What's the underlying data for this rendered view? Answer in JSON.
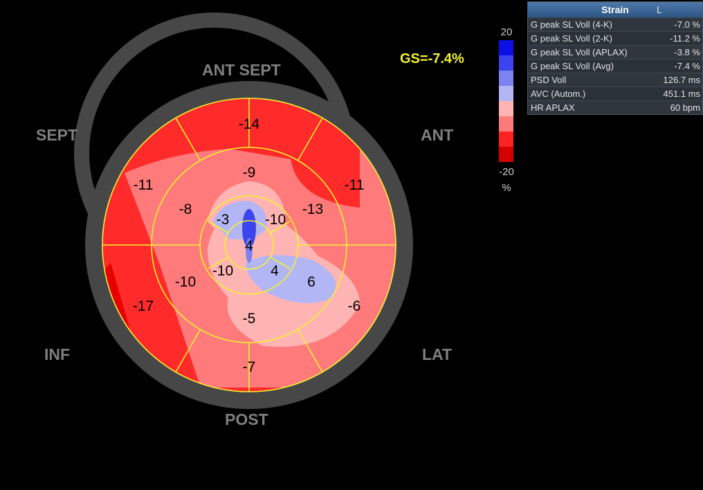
{
  "wall_labels": {
    "ant_sept": "ANT  SEPT",
    "sept": "SEPT",
    "ant": "ANT",
    "inf": "INF",
    "lat": "LAT",
    "post": "POST"
  },
  "global_strain_label": "GS=-7.4%",
  "color_scale": {
    "max": "20",
    "min": "-20",
    "unit": "%",
    "colors": [
      "#0a10e6",
      "#3c44f0",
      "#7c82f2",
      "#b3b6f4",
      "#ffb4b4",
      "#ff7a7a",
      "#ff2222",
      "#d40000"
    ]
  },
  "segments": {
    "basal": [
      {
        "wall": "ANT",
        "value": "-11"
      },
      {
        "wall": "ANT SEPT",
        "value": "-14"
      },
      {
        "wall": "SEPT",
        "value": "-11"
      },
      {
        "wall": "INF",
        "value": "-17"
      },
      {
        "wall": "POST",
        "value": "-7"
      },
      {
        "wall": "LAT",
        "value": "-6"
      }
    ],
    "mid": [
      {
        "wall": "ANT",
        "value": "-13"
      },
      {
        "wall": "ANT SEPT",
        "value": "-9"
      },
      {
        "wall": "SEPT",
        "value": "-8"
      },
      {
        "wall": "INF",
        "value": "-10"
      },
      {
        "wall": "POST",
        "value": "-5"
      },
      {
        "wall": "LAT",
        "value": "6"
      }
    ],
    "apical": [
      {
        "wall": "ANT",
        "value": "-10"
      },
      {
        "wall": "SEPT",
        "value": "-3"
      },
      {
        "wall": "INF",
        "value": "-10"
      },
      {
        "wall": "LAT",
        "value": "4"
      }
    ],
    "apex": {
      "value": "4"
    }
  },
  "strain_panel": {
    "title": "Strain",
    "marker": "L",
    "rows": [
      {
        "label": "G peak SL Voll (4-K)",
        "value": "-7.0 %"
      },
      {
        "label": "G peak SL Voll (2-K)",
        "value": "-11.2 %"
      },
      {
        "label": "G peak SL Voll (APLAX)",
        "value": "-3.8 %"
      },
      {
        "label": "G peak SL Voll (Avg)",
        "value": "-7.4 %"
      },
      {
        "label": "PSD Voll",
        "value": "126.7 ms"
      },
      {
        "label": "AVC (Autom.)",
        "value": "451.1 ms"
      },
      {
        "label": "HR APLAX",
        "value": "60 bpm"
      }
    ]
  }
}
